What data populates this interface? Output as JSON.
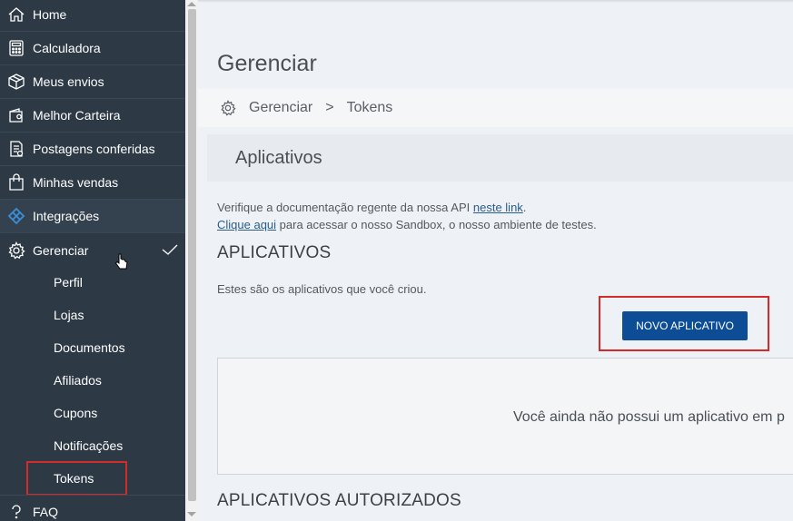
{
  "sidebar": {
    "items": [
      {
        "label": "Home",
        "icon": "home-icon"
      },
      {
        "label": "Calculadora",
        "icon": "calculator-icon"
      },
      {
        "label": "Meus envios",
        "icon": "package-icon"
      },
      {
        "label": "Melhor Carteira",
        "icon": "wallet-icon"
      },
      {
        "label": "Postagens conferidas",
        "icon": "receipt-icon"
      },
      {
        "label": "Minhas vendas",
        "icon": "shopping-bag-icon"
      },
      {
        "label": "Integrações",
        "icon": "integration-icon"
      },
      {
        "label": "Gerenciar",
        "icon": "gear-icon"
      }
    ],
    "subitems": [
      "Perfil",
      "Lojas",
      "Documentos",
      "Afiliados",
      "Cupons",
      "Notificações",
      "Tokens"
    ],
    "faq": "FAQ"
  },
  "main": {
    "title": "Gerenciar",
    "breadcrumb": {
      "root": "Gerenciar",
      "separator": ">",
      "current": "Tokens"
    },
    "section_title": "Aplicativos",
    "info": {
      "line1_pre": "Verifique a documentação regente da nossa API ",
      "line1_link": "neste link",
      "line1_post": ".",
      "line2_link": "Clique aqui",
      "line2_post": " para acessar o nosso Sandbox, o nosso ambiente de testes."
    },
    "apps_heading": "APLICATIVOS",
    "apps_desc": "Estes são os aplicativos que você criou.",
    "new_app_button": "NOVO APLICATIVO",
    "empty_message": "Você ainda não possui um aplicativo em p",
    "authorized_heading": "APLICATIVOS AUTORIZADOS"
  },
  "colors": {
    "sidebar_bg": "#2d3a46",
    "button_bg": "#0c4d96",
    "highlight": "#d42a2a",
    "integration_icon": "#3b8fd6"
  }
}
